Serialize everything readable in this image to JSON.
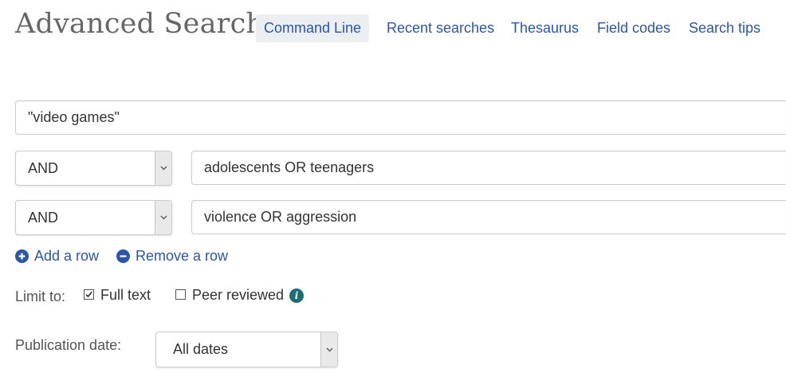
{
  "page": {
    "title": "Advanced Search"
  },
  "nav": [
    {
      "label": "Command Line",
      "active": true
    },
    {
      "label": "Recent searches"
    },
    {
      "label": "Thesaurus"
    },
    {
      "label": "Field codes"
    },
    {
      "label": "Search tips"
    }
  ],
  "search_rows": [
    {
      "term": "\"video games\""
    },
    {
      "operator": "AND",
      "term": "adolescents OR teenagers"
    },
    {
      "operator": "AND",
      "term": "violence OR aggression"
    }
  ],
  "row_actions": {
    "add_label": "Add a row",
    "remove_label": "Remove a row"
  },
  "limit": {
    "label": "Limit to:",
    "full_text": {
      "label": "Full text",
      "checked": true
    },
    "peer_reviewed": {
      "label": "Peer reviewed",
      "checked": false,
      "info_icon": "i"
    }
  },
  "publication_date": {
    "label": "Publication date:",
    "selected": "All dates"
  },
  "colors": {
    "link": "#2c55a8",
    "info": "#1b6e75",
    "active_tab_bg": "#ebeff1"
  }
}
